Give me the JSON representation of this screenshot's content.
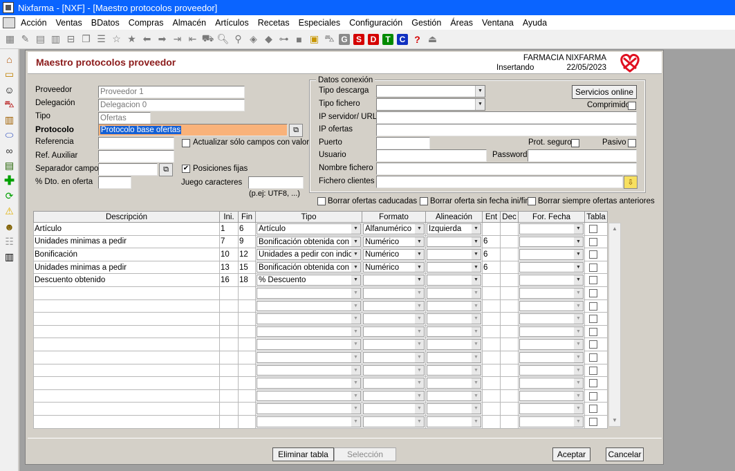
{
  "window_title": "Nixfarma - [NXF] - [Maestro protocolos proveedor]",
  "menu": [
    "Acción",
    "Ventas",
    "BDatos",
    "Compras",
    "Almacén",
    "Artículos",
    "Recetas",
    "Especiales",
    "Configuración",
    "Gestión",
    "Áreas",
    "Ventana",
    "Ayuda"
  ],
  "toolbar_boxes": {
    "g": "G",
    "s": "S",
    "d": "D",
    "t": "T",
    "c": "C",
    "help": "?"
  },
  "colors": {
    "title_bar": "#0a64ff",
    "header_title": "#8b1a1a",
    "highlight": "#f9b27a",
    "selection": "#1560d4"
  },
  "header": {
    "title": "Maestro protocolos proveedor",
    "pharmacy": "FARMACIA NIXFARMA",
    "mode": "Insertando",
    "date": "22/05/2023"
  },
  "form": {
    "proveedor_label": "Proveedor",
    "proveedor_value": "Proveedor 1",
    "delegacion_label": "Delegación",
    "delegacion_value": "Delegacion 0",
    "tipo_label": "Tipo",
    "tipo_value": "Ofertas",
    "protocolo_label": "Protocolo",
    "protocolo_value": "Protocolo base ofertas",
    "referencia_label": "Referencia",
    "ref_auxiliar_label": "Ref. Auxiliar",
    "separador_label": "Separador campos",
    "dto_label": "% Dto. en oferta",
    "actualizar_label": "Actualizar sólo campos con valor",
    "posiciones_label": "Posiciones fijas",
    "juego_label": "Juego caracteres",
    "juego_hint": "(p.ej: UTF8, ...)"
  },
  "conexion": {
    "group_title": "Datos conexión",
    "tipo_descarga_label": "Tipo descarga",
    "tipo_fichero_label": "Tipo fichero",
    "servicios_button": "Servicios online",
    "comprimido_label": "Comprimido",
    "ip_servidor_label": "IP servidor/ URL",
    "ip_ofertas_label": "IP ofertas",
    "puerto_label": "Puerto",
    "prot_seguro_label": "Prot. seguro",
    "pasivo_label": "Pasivo",
    "usuario_label": "Usuario",
    "password_label": "Password",
    "nombre_fichero_label": "Nombre fichero",
    "fichero_clientes_label": "Fichero clientes"
  },
  "options": {
    "borrar_caducadas": "Borrar ofertas caducadas",
    "borrar_sin_fecha": "Borrar oferta sin fecha ini/fin",
    "borrar_anteriores": "Borrar siempre ofertas anteriores"
  },
  "grid": {
    "headers": [
      "Descripción",
      "Ini.",
      "Fin",
      "Tipo",
      "Formato",
      "Alineación",
      "Ent",
      "Dec",
      "For. Fecha",
      "Tabla"
    ],
    "rows": [
      {
        "desc": "Artículo",
        "ini": "1",
        "fin": "6",
        "tipo": "Artículo",
        "formato": "Alfanumérico",
        "alineacion": "Izquierda",
        "ent": "",
        "dec": ""
      },
      {
        "desc": "Unidades minimas a pedir",
        "ini": "7",
        "fin": "9",
        "tipo": "Bonificación obtenida con importe",
        "formato": "Numérico",
        "alineacion": "",
        "ent": "6",
        "dec": ""
      },
      {
        "desc": "Bonificación",
        "ini": "10",
        "fin": "12",
        "tipo": "Unidades a pedir con indicación",
        "formato": "Numérico",
        "alineacion": "",
        "ent": "6",
        "dec": ""
      },
      {
        "desc": "Unidades minimas a pedir",
        "ini": "13",
        "fin": "15",
        "tipo": "Bonificación obtenida con importe",
        "formato": "Numérico",
        "alineacion": "",
        "ent": "6",
        "dec": ""
      },
      {
        "desc": "Descuento obtenido",
        "ini": "16",
        "fin": "18",
        "tipo": "% Descuento",
        "formato": "",
        "alineacion": "",
        "ent": "",
        "dec": ""
      }
    ],
    "empty_rows": 11
  },
  "buttons": {
    "eliminar": "Eliminar tabla",
    "seleccion": "Selección",
    "aceptar": "Aceptar",
    "cancelar": "Cancelar"
  }
}
